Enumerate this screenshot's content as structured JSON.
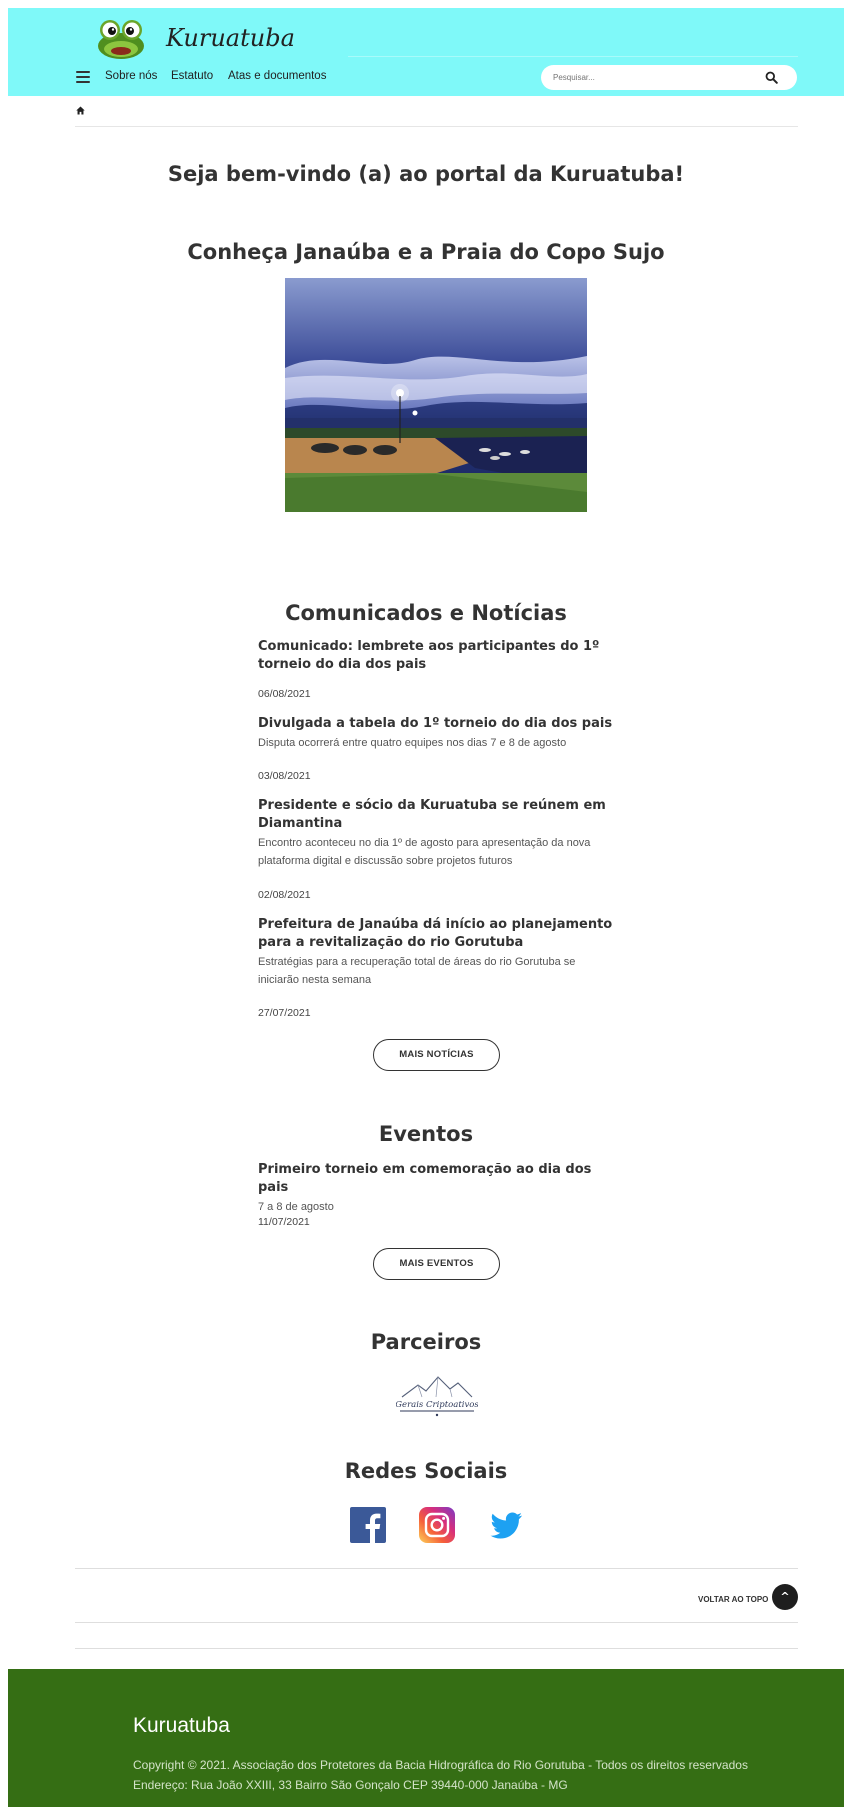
{
  "header": {
    "logo_text": "Kuruatuba",
    "nav": [
      "Sobre nós",
      "Estatuto",
      "Atas e documentos"
    ],
    "search_placeholder": "Pesquisar..."
  },
  "welcome_title": "Seja bem-vindo (a) ao portal da Kuruatuba!",
  "feature_title": "Conheça Janaúba e a Praia do Copo Sujo",
  "news": {
    "title": "Comunicados e Notícias",
    "items": [
      {
        "title": "Comunicado: lembrete aos participantes do 1º torneio do dia dos pais",
        "subtitle": "",
        "date": "06/08/2021"
      },
      {
        "title": "Divulgada a tabela do 1º torneio do dia dos pais",
        "subtitle": "Disputa ocorrerá entre quatro equipes nos dias 7 e 8 de agosto",
        "date": "03/08/2021"
      },
      {
        "title": "Presidente e sócio da Kuruatuba se reúnem em Diamantina",
        "subtitle": "Encontro aconteceu no dia 1º de agosto para apresentação da nova plataforma digital e discussão sobre projetos futuros",
        "date": "02/08/2021"
      },
      {
        "title": "Prefeitura de Janaúba dá início ao planejamento para a revitalização do rio Gorutuba",
        "subtitle": "Estratégias para a recuperação total de áreas do rio Gorutuba se iniciarão nesta semana",
        "date": "27/07/2021"
      }
    ],
    "more_label": "MAIS NOTÍCIAS"
  },
  "events": {
    "title": "Eventos",
    "items": [
      {
        "title": "Primeiro torneio em comemoração ao dia dos pais",
        "subtitle": "7 a 8 de agosto",
        "date": "11/07/2021"
      }
    ],
    "more_label": "MAIS EVENTOS"
  },
  "partners": {
    "title": "Parceiros",
    "logo_text": "Gerais Criptoativos"
  },
  "social": {
    "title": "Redes Sociais",
    "icons": [
      "facebook-icon",
      "instagram-icon",
      "twitter-icon"
    ],
    "colors": {
      "facebook": "#3b5998",
      "twitter": "#1da1f2"
    }
  },
  "back_to_top_label": "VOLTAR AO TOPO",
  "back_to_top_glyph": "^",
  "footer": {
    "title": "Kuruatuba",
    "copyright": "Copyright © 2021. Associação dos Protetores da Bacia Hidrográfica do Rio Gorutuba - Todos os direitos reservados",
    "address": "Endereço: Rua João XXIII, 33 Bairro São Gonçalo CEP 39440-000 Janaúba - MG"
  },
  "colors": {
    "header_bg": "#7ff9f9",
    "footer_bg": "#356e14"
  }
}
